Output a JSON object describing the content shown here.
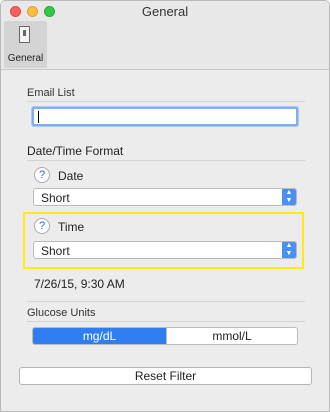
{
  "window": {
    "title": "General"
  },
  "toolbar": {
    "general_label": "General",
    "general_icon": "switch-icon"
  },
  "email": {
    "section_label": "Email List",
    "value": ""
  },
  "datetime": {
    "section_label": "Date/Time Format",
    "date": {
      "label": "Date",
      "help": "?",
      "value": "Short"
    },
    "time": {
      "label": "Time",
      "help": "?",
      "value": "Short"
    },
    "sample": "7/26/15, 9:30 AM"
  },
  "glucose": {
    "section_label": "Glucose Units",
    "options": [
      "mg/dL",
      "mmol/L"
    ],
    "selected": "mg/dL"
  },
  "reset_label": "Reset Filter",
  "colors": {
    "accent": "#2f7ef1",
    "highlight": "#ffeb10"
  }
}
